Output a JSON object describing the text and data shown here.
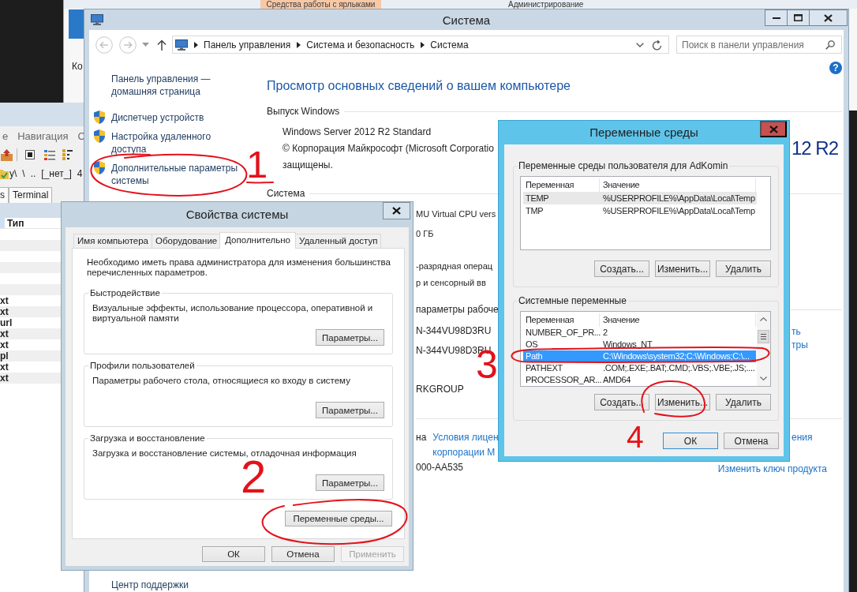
{
  "explorer_window": {
    "contextual_tab": "Средства работы с ярлыками",
    "title": "Администрирование",
    "ribbon_label": "Ко"
  },
  "file_manager": {
    "menu": [
      "е",
      "Навигация",
      "С"
    ],
    "path": [
      "y\\",
      "\\",
      "..",
      "[_нет_]",
      "4"
    ],
    "tabs": [
      "s",
      "Terminal"
    ],
    "column": "Тип",
    "types": [
      "xt",
      "xt",
      "url",
      "xt",
      "xt",
      "pl",
      "xt",
      "xt"
    ]
  },
  "system_window": {
    "title": "Система",
    "breadcrumbs": [
      "Панель управления",
      "Система и безопасность",
      "Система"
    ],
    "search": {
      "placeholder": "Поиск в панели управления"
    },
    "help": "?",
    "sidebar": {
      "home": "Панель управления — домашняя страница",
      "links": [
        "Диспетчер устройств",
        "Настройка удаленного доступа",
        "Дополнительные параметры системы"
      ],
      "footer": "Центр поддержки"
    },
    "heading": "Просмотр основных сведений о вашем компьютере",
    "edition": {
      "heading": "Выпуск Windows",
      "name": "Windows Server 2012 R2 Standard",
      "copyright": [
        "© Корпорация Майкрософт (Microsoft Corporatio",
        "защищены."
      ],
      "logo": "12 R2"
    },
    "system": {
      "heading": "Система",
      "values": [
        "MU Virtual CPU vers",
        "0 ГБ",
        "-разрядная операц",
        "р и сенсорный вв"
      ]
    },
    "computer_name": {
      "heading": "параметры рабоче",
      "values": [
        "N-344VU98D3RU",
        "N-344VU98D3RU",
        "RKGROUP"
      ],
      "links": [
        "ть",
        "тры"
      ]
    },
    "activation": {
      "status": "на",
      "license_link": [
        "Условия лицен",
        "корпорации М"
      ],
      "side_link": "ения",
      "product_id": "000-AA535",
      "change_key_link": "Изменить ключ продукта"
    }
  },
  "system_properties": {
    "title": "Свойства системы",
    "tabs": [
      {
        "label": "Имя компьютера",
        "selected": false
      },
      {
        "label": "Оборудование",
        "selected": false
      },
      {
        "label": "Дополнительно",
        "selected": true
      },
      {
        "label": "Удаленный доступ",
        "selected": false
      }
    ],
    "note": "Необходимо иметь права администратора для изменения большинства перечисленных параметров.",
    "groups": [
      {
        "title": "Быстродействие",
        "text": "Визуальные эффекты, использование процессора, оперативной и виртуальной памяти",
        "button": "Параметры..."
      },
      {
        "title": "Профили пользователей",
        "text": "Параметры рабочего стола, относящиеся ко входу в систему",
        "button": "Параметры..."
      },
      {
        "title": "Загрузка и восстановление",
        "text": "Загрузка и восстановление системы, отладочная информация",
        "button": "Параметры..."
      }
    ],
    "env_button": "Переменные среды...",
    "buttons": [
      {
        "label": "ОК",
        "disabled": false
      },
      {
        "label": "Отмена",
        "disabled": false
      },
      {
        "label": "Применить",
        "disabled": true
      }
    ]
  },
  "environment_variables": {
    "title": "Переменные среды",
    "user_group": {
      "title": "Переменные среды пользователя для AdKomin",
      "focused": false,
      "columns": [
        "Переменная",
        "Значение"
      ],
      "rows": [
        {
          "name": "TEMP",
          "value": "%USERPROFILE%\\AppData\\Local\\Temp",
          "selected": true
        },
        {
          "name": "TMP",
          "value": "%USERPROFILE%\\AppData\\Local\\Temp",
          "selected": false
        }
      ],
      "buttons": [
        "Создать...",
        "Изменить...",
        "Удалить"
      ]
    },
    "system_group": {
      "title": "Системные переменные",
      "focused": true,
      "columns": [
        "Переменная",
        "Значение"
      ],
      "rows": [
        {
          "name": "NUMBER_OF_PR...",
          "value": "2",
          "selected": false
        },
        {
          "name": "OS",
          "value": "Windows_NT",
          "selected": false
        },
        {
          "name": "Path",
          "value": "C:\\Windows\\system32;C:\\Windows;C:\\...",
          "selected": true
        },
        {
          "name": "PATHEXT",
          "value": ".COM;.EXE;.BAT;.CMD;.VBS;.VBE;.JS;....",
          "selected": false
        },
        {
          "name": "PROCESSOR_AR...",
          "value": "AMD64",
          "selected": false
        }
      ],
      "buttons": [
        "Создать...",
        "Изменить...",
        "Удалить"
      ]
    },
    "buttons": [
      {
        "label": "ОК",
        "default": true
      },
      {
        "label": "Отмена",
        "default": false
      }
    ]
  },
  "annotations": [
    "1",
    "2",
    "3",
    "4"
  ]
}
